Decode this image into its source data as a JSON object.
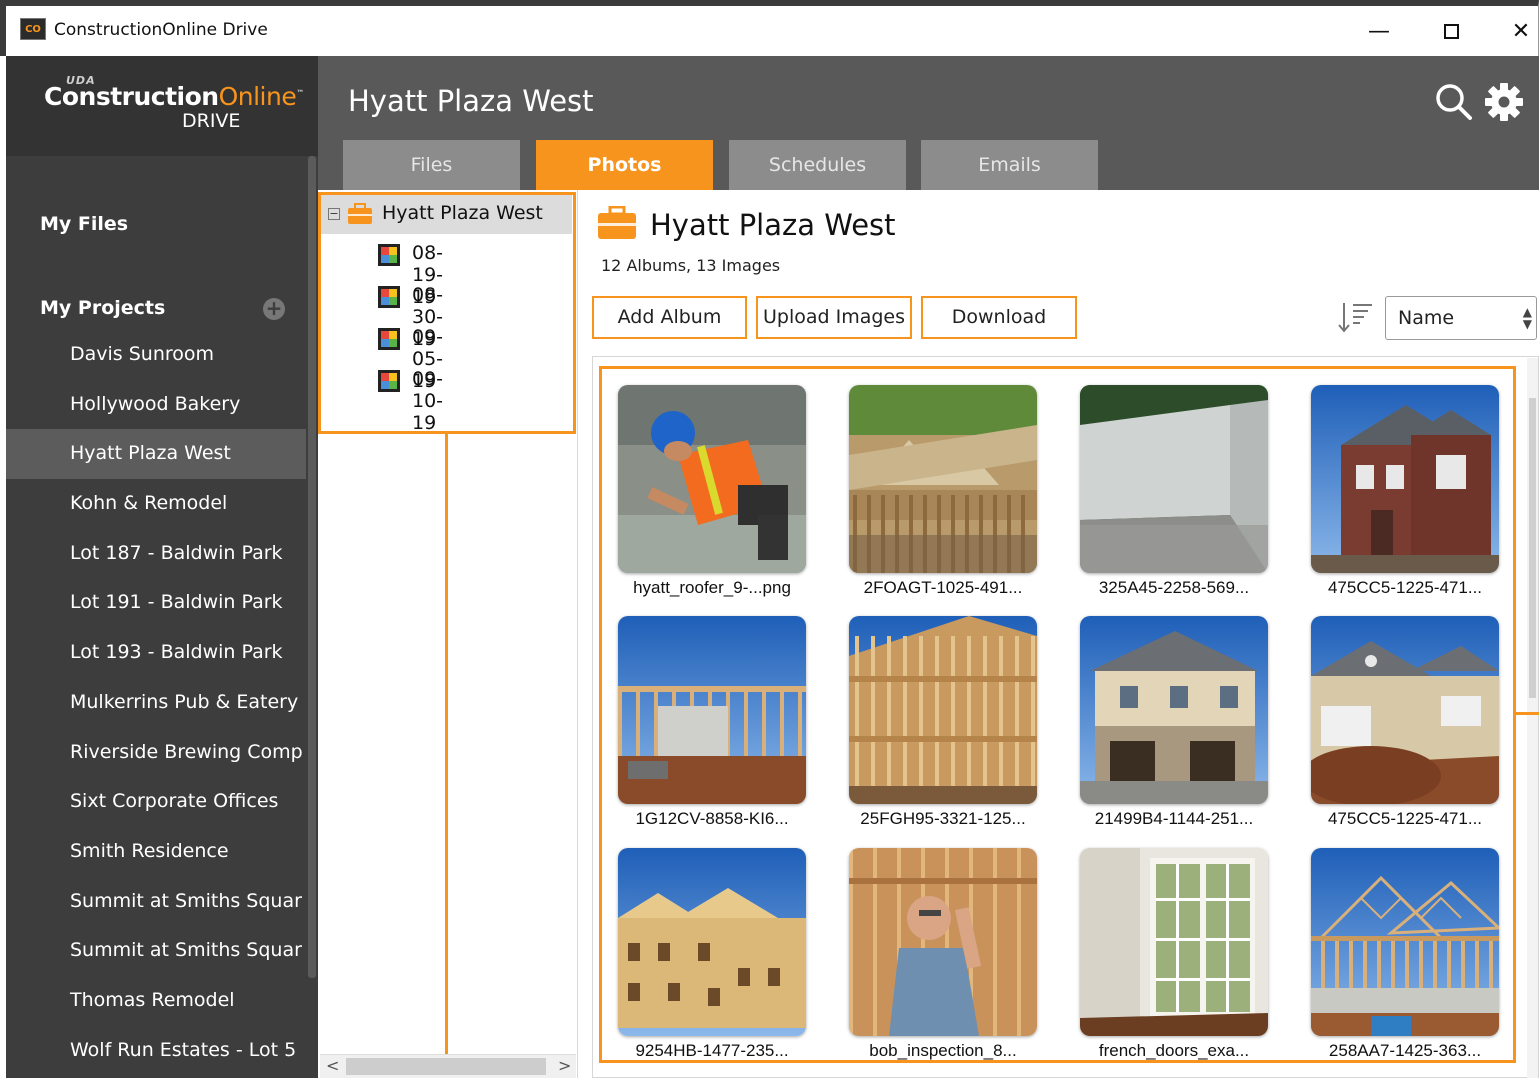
{
  "window": {
    "icon_text": "CO",
    "title": "ConstructionOnline Drive",
    "minimize": "—",
    "close": "✕"
  },
  "logo": {
    "uda": "UDA",
    "brand_a": "Construction",
    "brand_b": "Online",
    "tm": "™",
    "drive": "DRIVE"
  },
  "sidebar": {
    "my_files": "My Files",
    "my_projects": "My Projects",
    "add_symbol": "+",
    "projects": [
      {
        "label": "Davis Sunroom",
        "active": false
      },
      {
        "label": "Hollywood Bakery",
        "active": false
      },
      {
        "label": "Hyatt Plaza West",
        "active": true
      },
      {
        "label": "Kohn & Remodel",
        "active": false
      },
      {
        "label": "Lot 187 - Baldwin Park",
        "active": false
      },
      {
        "label": "Lot 191 - Baldwin Park",
        "active": false
      },
      {
        "label": "Lot 193 - Baldwin Park",
        "active": false
      },
      {
        "label": "Mulkerrins Pub & Eatery",
        "active": false
      },
      {
        "label": "Riverside Brewing Comp",
        "active": false
      },
      {
        "label": "Sixt Corporate Offices",
        "active": false
      },
      {
        "label": "Smith Residence",
        "active": false
      },
      {
        "label": "Summit at Smiths Squar",
        "active": false
      },
      {
        "label": "Summit at Smiths Squar",
        "active": false
      },
      {
        "label": "Thomas Remodel",
        "active": false
      },
      {
        "label": "Wolf Run Estates - Lot 5",
        "active": false
      }
    ]
  },
  "header": {
    "title": "Hyatt Plaza West",
    "tabs": [
      {
        "label": "Files",
        "active": false
      },
      {
        "label": "Photos",
        "active": true
      },
      {
        "label": "Schedules",
        "active": false
      },
      {
        "label": "Emails",
        "active": false
      }
    ]
  },
  "tree": {
    "toggle": "−",
    "root": "Hyatt Plaza West",
    "albums": [
      "08-19-19",
      "08-30-19",
      "09-05-19",
      "09-10-19"
    ],
    "scroll_left": "<",
    "scroll_right": ">"
  },
  "main": {
    "title": "Hyatt Plaza West",
    "subtitle": "12 Albums, 13 Images",
    "buttons": {
      "add_album": "Add Album",
      "upload": "Upload Images",
      "download": "Download"
    },
    "sort": {
      "selected": "Name"
    },
    "images": [
      {
        "name": "hyatt_roofer_9-...png",
        "scene": "roofer"
      },
      {
        "name": "2FOAGT-1025-491...",
        "scene": "roof-framing"
      },
      {
        "name": "325A45-2258-569...",
        "scene": "foundation"
      },
      {
        "name": "475CC5-1225-471...",
        "scene": "brick-house"
      },
      {
        "name": "1G12CV-8858-KI6...",
        "scene": "wall-framing"
      },
      {
        "name": "25FGH95-3321-125...",
        "scene": "stud-framing"
      },
      {
        "name": "21499B4-1144-251...",
        "scene": "stone-house"
      },
      {
        "name": "475CC5-1225-471...",
        "scene": "garage-house"
      },
      {
        "name": "9254HB-1477-235...",
        "scene": "townhomes"
      },
      {
        "name": "bob_inspection_8...",
        "scene": "inspector"
      },
      {
        "name": "french_doors_exa...",
        "scene": "french-doors"
      },
      {
        "name": "258AA7-1425-363...",
        "scene": "frame-house"
      }
    ]
  },
  "colors": {
    "accent": "#f7941d",
    "sidebar_bg": "#3d3d3d",
    "header_bg": "#595959",
    "tab_inactive": "#8c8c8c"
  }
}
